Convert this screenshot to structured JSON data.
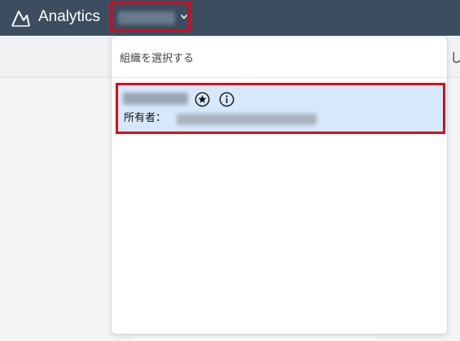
{
  "topbar": {
    "app_title": "Analytics",
    "logo_icon": "analytics-logo-icon",
    "account_selector_icon": "chevron-down-icon"
  },
  "background": {
    "partial_text": "し"
  },
  "dropdown": {
    "header": "組織を選択する",
    "items": [
      {
        "owner_label": "所有者：",
        "icons": [
          "star-icon",
          "info-icon"
        ],
        "selected": true
      }
    ]
  },
  "colors": {
    "topbar": "#3b4d5f",
    "highlight_border": "#e1001a",
    "selected_item": "#d6e8fb"
  }
}
